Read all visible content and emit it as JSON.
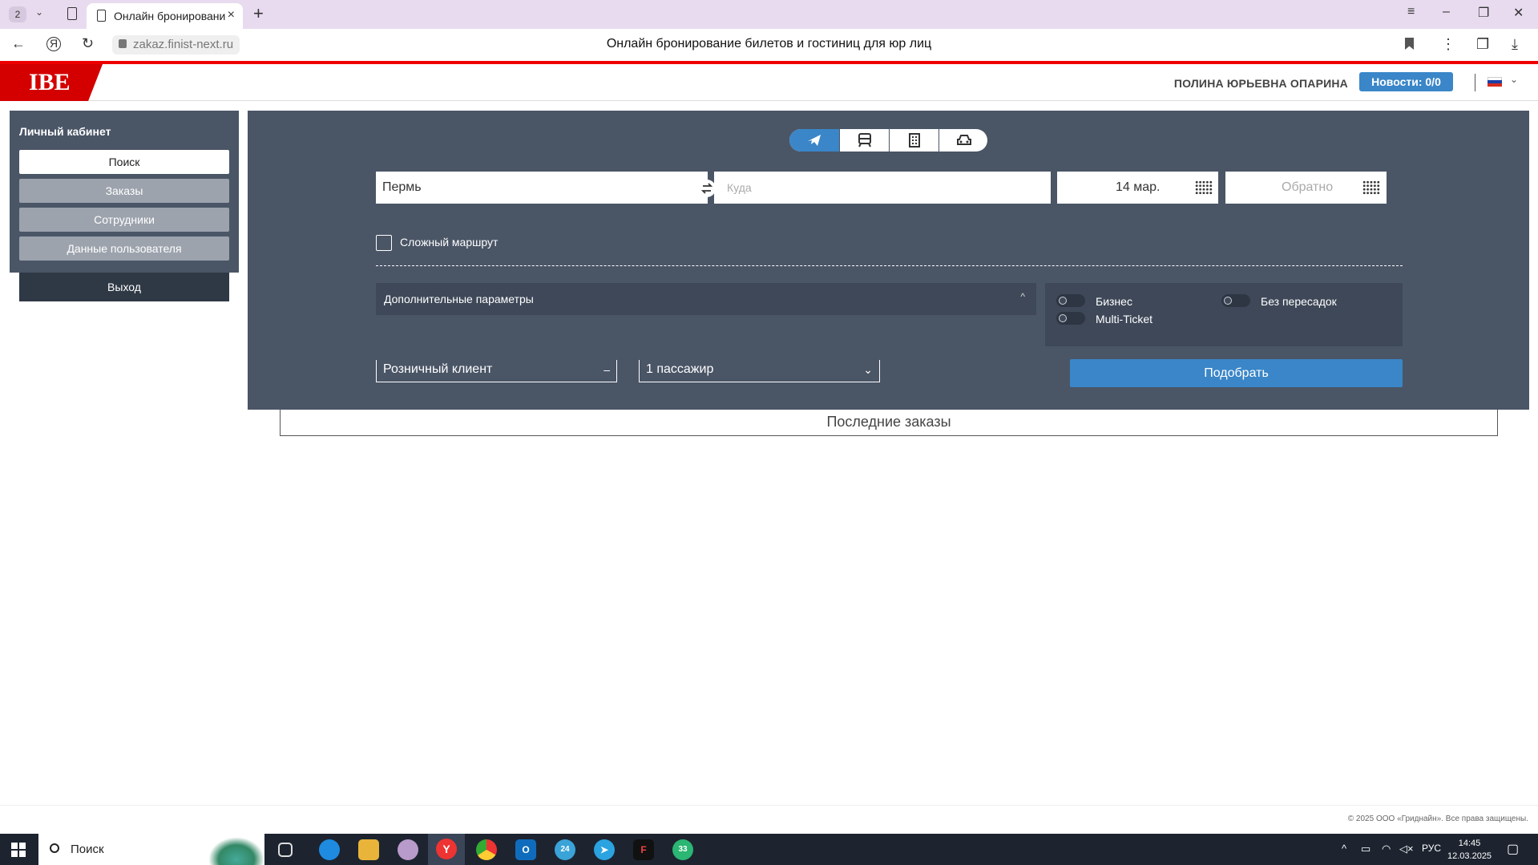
{
  "browser": {
    "tab_count": "2",
    "active_tab_title": "Онлайн бронирование",
    "url": "zakaz.finist-next.ru",
    "page_title": "Онлайн бронирование билетов и гостиниц для юр лиц"
  },
  "header": {
    "logo": "IBE",
    "user_name": "ПОЛИНА ЮРЬЕВНА ОПАРИНА",
    "news_label": "Новости: 0/0",
    "language_icon": "russian-flag-icon"
  },
  "sidebar": {
    "title": "Личный кабинет",
    "items": [
      {
        "label": "Поиск",
        "active": true
      },
      {
        "label": "Заказы",
        "active": false
      },
      {
        "label": "Сотрудники",
        "active": false
      },
      {
        "label": "Данные пользователя",
        "active": false
      }
    ],
    "logout_label": "Выход"
  },
  "search": {
    "modes": [
      {
        "icon": "plane-icon",
        "active": true
      },
      {
        "icon": "train-icon",
        "active": false
      },
      {
        "icon": "hotel-icon",
        "active": false
      },
      {
        "icon": "car-icon",
        "active": false
      }
    ],
    "from_value": "Пермь",
    "to_placeholder": "Куда",
    "date_value": "14 мар.",
    "return_placeholder": "Обратно",
    "complex_route_label": "Сложный маршрут",
    "complex_route_checked": false,
    "extra_params_label": "Дополнительные параметры",
    "toggles": [
      {
        "label": "Бизнес",
        "on": false
      },
      {
        "label": "Без пересадок",
        "on": false
      },
      {
        "label": "Multi-Ticket",
        "on": false
      }
    ],
    "client_type": "Розничный клиент",
    "passengers": "1 пассажир",
    "submit_label": "Подобрать"
  },
  "last_orders_title": "Последние заказы",
  "footer": {
    "copyright": "© 2025 ООО «Гриднайн». Все права защищены."
  },
  "taskbar": {
    "search_label": "Поиск",
    "language": "РУС",
    "time": "14:45",
    "date": "12.03.2025"
  },
  "colors": {
    "brand_red": "#d40000",
    "accent_blue": "#3a86c8",
    "panel_bg": "#4a5566"
  }
}
